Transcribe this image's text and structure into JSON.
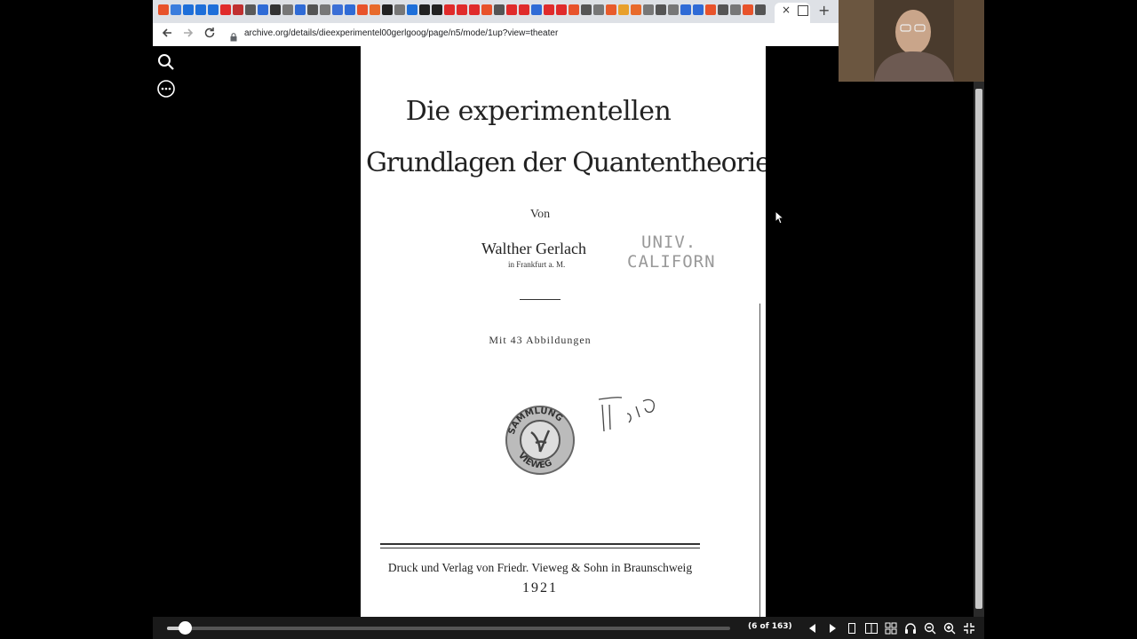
{
  "browser": {
    "url": "archive.org/details/dieexperimentel00gerlgoog/page/n5/mode/1up?view=theater",
    "tab_close": "×",
    "new_tab": "+",
    "favicon_colors": [
      "#e8532b",
      "#3b7ddd",
      "#1e6fd9",
      "#1e6fd9",
      "#1e6fd9",
      "#e02b2b",
      "#c03030",
      "#5a5a5a",
      "#2f6bd6",
      "#333333",
      "#777777",
      "#2f6bd6",
      "#555555",
      "#777777",
      "#3b6fd6",
      "#2f6bd6",
      "#e8532b",
      "#e86a2b",
      "#222222",
      "#777777",
      "#1e6fd9",
      "#222222",
      "#222222",
      "#e02b2b",
      "#e02b2b",
      "#e02b2b",
      "#e8532b",
      "#555555",
      "#e02b2b",
      "#e02b2b",
      "#2f6bd6",
      "#e02b2b",
      "#e02b2b",
      "#e8532b",
      "#555555",
      "#777777",
      "#e85b2b",
      "#e8a02b",
      "#e86a2b",
      "#777777",
      "#555555",
      "#777777",
      "#2f6bd6",
      "#2f6bd6",
      "#e8532b",
      "#555555",
      "#777777",
      "#e8532b",
      "#555555"
    ]
  },
  "viewer": {
    "page_count": "(6 of 163)",
    "progress": 0.031
  },
  "book_page": {
    "title_line1": "Die experimentellen",
    "title_line2": "Grundlagen der Quantentheorie",
    "von": "Von",
    "author": "Walther Gerlach",
    "location": "in Frankfurt a. M.",
    "stamp_line1": "UNIV.",
    "stamp_line2": "CALIFORN",
    "illustrations": "Mit 43 Abbildungen",
    "seal_top": "SAMMLUNG",
    "seal_bottom": "VIEWEG",
    "publisher": "Druck und Verlag von Friedr. Vieweg & Sohn in Braunschweig",
    "year": "1921"
  }
}
